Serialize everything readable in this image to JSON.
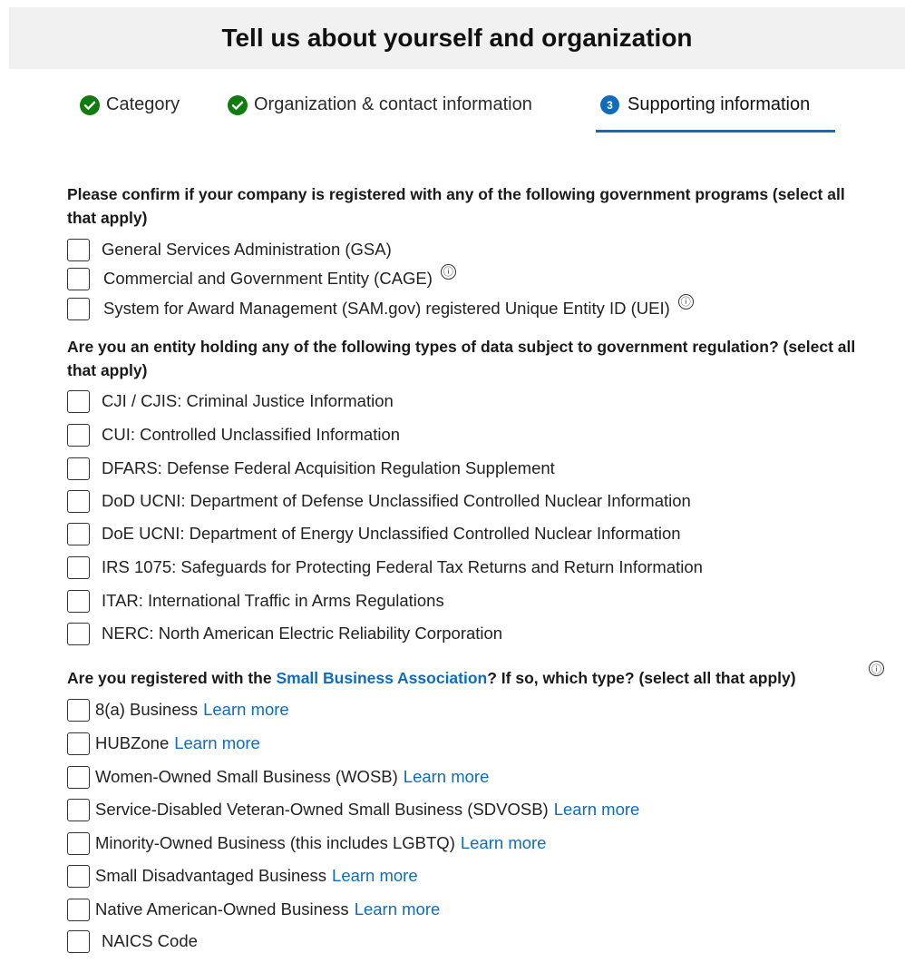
{
  "header": {
    "title": "Tell us about yourself and organization"
  },
  "steps": [
    {
      "label": "Category",
      "state": "complete",
      "icon": "check-circle-icon"
    },
    {
      "label": "Organization & contact information",
      "state": "complete",
      "icon": "check-circle-icon"
    },
    {
      "label": "Supporting information",
      "state": "active",
      "number": "3"
    }
  ],
  "colors": {
    "accent": "#0f6cbd",
    "complete": "#107c10",
    "header_bg": "#f1f1f1"
  },
  "gov_programs": {
    "question": "Please confirm if your company is registered with any of the following government programs (select all that apply)",
    "options": [
      {
        "label": "General Services Administration (GSA)",
        "checked": false
      },
      {
        "label": "Commercial and Government Entity (CAGE)",
        "checked": false,
        "info_icon": "ⓘ"
      },
      {
        "label": "System for Award Management (SAM.gov) registered Unique Entity ID (UEI)",
        "checked": false,
        "info_icon": "ⓘ"
      }
    ]
  },
  "data_types": {
    "question": "Are you an entity holding any of the following types of data subject to government regulation? (select all that apply)",
    "options": [
      {
        "label": "CJI / CJIS: Criminal Justice Information",
        "checked": false
      },
      {
        "label": "CUI: Controlled Unclassified Information",
        "checked": false
      },
      {
        "label": "DFARS: Defense Federal Acquisition Regulation Supplement",
        "checked": false
      },
      {
        "label": "DoD UCNI: Department of Defense Unclassified Controlled Nuclear Information",
        "checked": false
      },
      {
        "label": "DoE UCNI: Department of Energy Unclassified Controlled Nuclear Information",
        "checked": false
      },
      {
        "label": "IRS 1075: Safeguards for Protecting Federal Tax Returns and Return Information",
        "checked": false
      },
      {
        "label": "ITAR: International Traffic in Arms Regulations",
        "checked": false
      },
      {
        "label": "NERC: North American Electric Reliability Corporation",
        "checked": false
      }
    ]
  },
  "sba": {
    "question_prefix": "Are you registered with the ",
    "question_link": "Small Business Association",
    "question_suffix": "? If so, which type? (select all that apply)",
    "info_icon": "ⓘ",
    "learn_more": "Learn more",
    "options": [
      {
        "label": "8(a) Business",
        "learn_more": "Learn more",
        "checked": false
      },
      {
        "label": "HUBZone",
        "learn_more": "Learn more",
        "checked": false
      },
      {
        "label": "Women-Owned Small Business (WOSB)",
        "learn_more": "Learn more",
        "checked": false
      },
      {
        "label": "Service-Disabled Veteran-Owned Small Business (SDVOSB)",
        "learn_more": "Learn more",
        "checked": false
      },
      {
        "label": "Minority-Owned Business (this includes LGBTQ)",
        "learn_more": "Learn more",
        "checked": false
      },
      {
        "label": "Small Disadvantaged Business",
        "learn_more": "Learn more",
        "checked": false
      },
      {
        "label": "Native American-Owned Business",
        "learn_more": "Learn more",
        "checked": false
      },
      {
        "label": "NAICS Code",
        "checked": false
      }
    ]
  }
}
